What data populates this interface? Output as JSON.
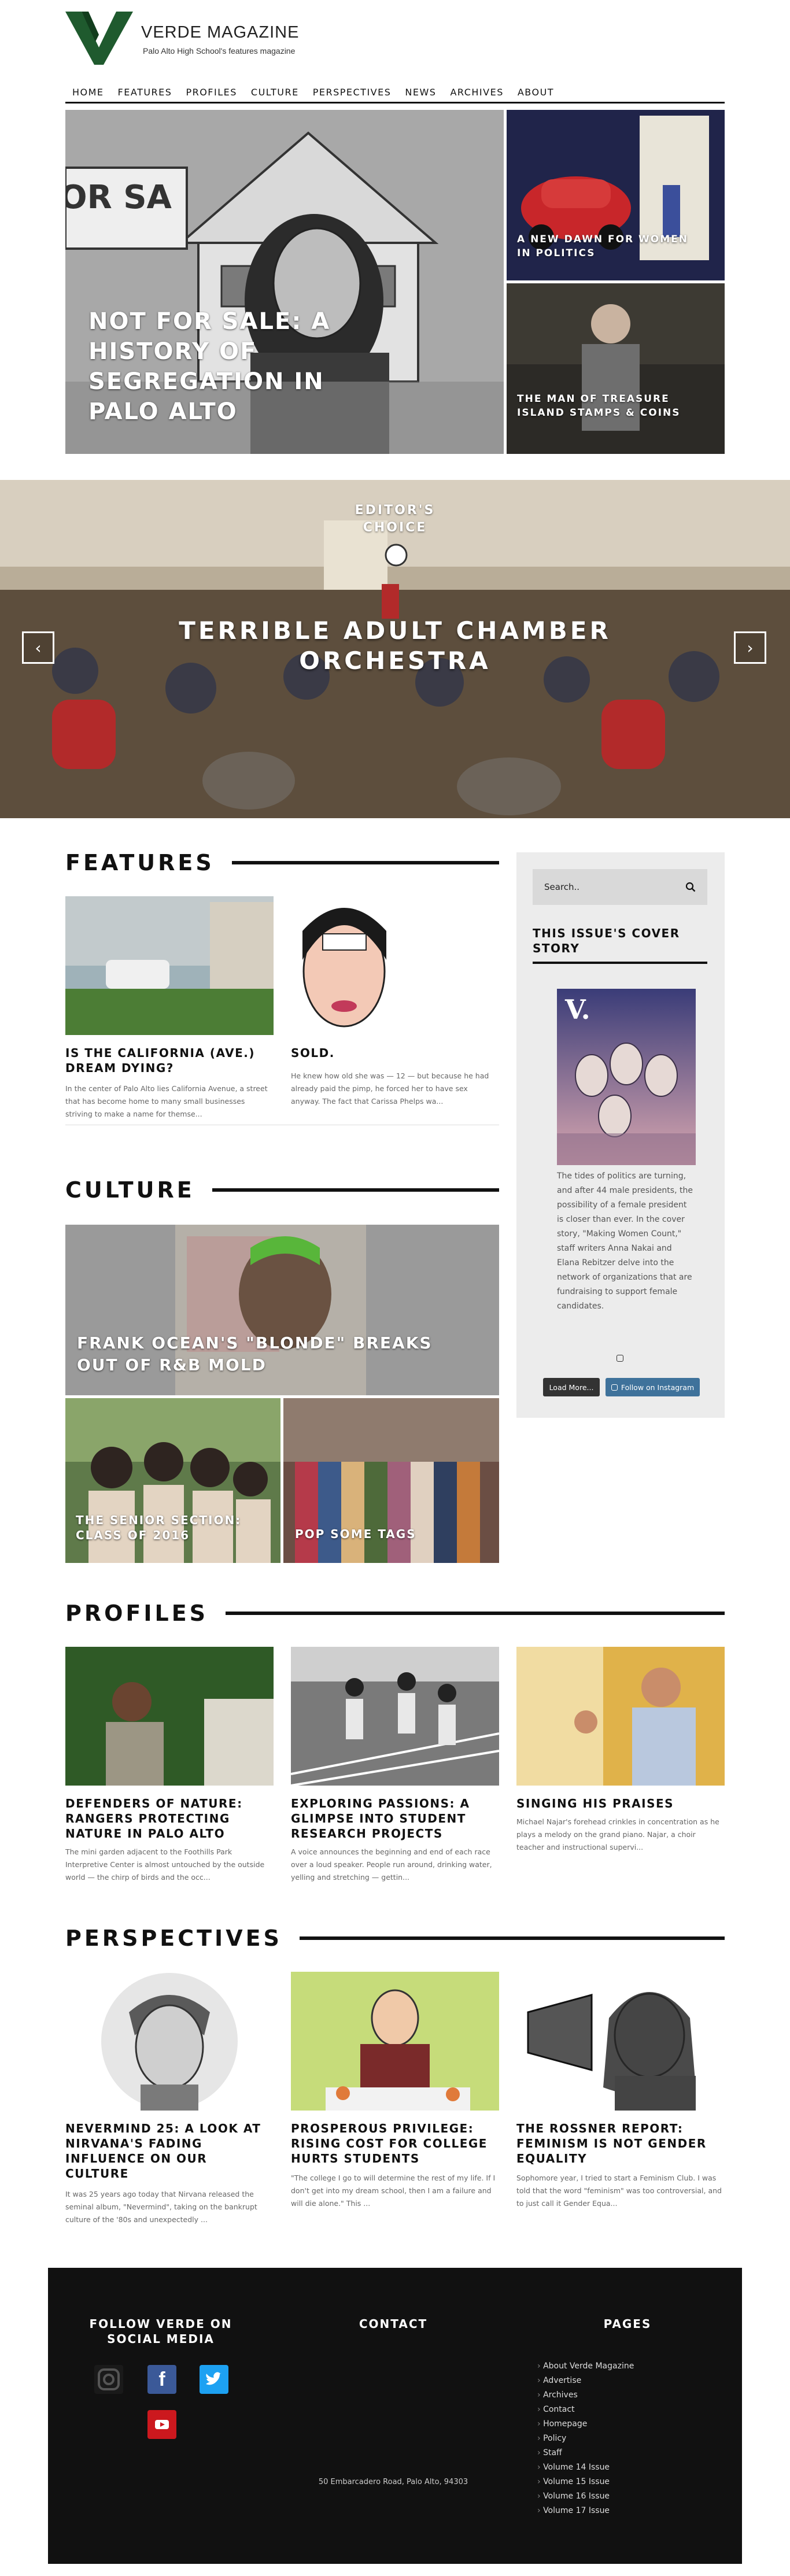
{
  "header": {
    "logo_letter": "V",
    "brand_name": "VERDE MAGAZINE",
    "tagline": "Palo Alto High School's features magazine"
  },
  "nav": [
    "HOME",
    "FEATURES",
    "PROFILES",
    "CULTURE",
    "PERSPECTIVES",
    "NEWS",
    "ARCHIVES",
    "ABOUT"
  ],
  "hero": {
    "main_title": "NOT FOR SALE: A HISTORY OF SEGREGATION IN PALO ALTO",
    "side_top_title": "A NEW DAWN FOR WOMEN IN POLITICS",
    "side_bottom_title": "THE MAN OF TREASURE ISLAND STAMPS & COINS"
  },
  "editors_choice": {
    "label_line1": "EDITOR'S",
    "label_line2": "CHOICE",
    "title_line1": "TERRIBLE ADULT CHAMBER",
    "title_line2": "ORCHESTRA",
    "prev": "‹",
    "next": "›"
  },
  "features": {
    "heading": "FEATURES",
    "items": [
      {
        "title": "IS THE CALIFORNIA (AVE.) DREAM DYING?",
        "text": "In the center of Palo Alto lies California Avenue, a street that has become home to many small businesses striving to make a name for themse..."
      },
      {
        "title": "SOLD.",
        "text": "He knew how old she was — 12 — but because he had already paid the pimp, he forced her to have sex anyway. The fact that Carissa Phelps wa..."
      }
    ]
  },
  "sidebar": {
    "search_placeholder": "Search..",
    "cover_title": "THIS ISSUE'S COVER STORY",
    "cover_text": "The tides of politics are turning, and after 44 male presidents, the possibility of a female president is closer than ever. In the cover story, \"Making Women Count,\" staff writers Anna Nakai and Elana Rebitzer delve into the network of organizations that are fundraising to support female candidates.",
    "load_more": "Load More...",
    "follow_instagram": "Follow on Instagram"
  },
  "culture": {
    "heading": "CULTURE",
    "main_title": "FRANK OCEAN'S \"BLONDE\" BREAKS OUT OF R&B MOLD",
    "left_title": "THE SENIOR SECTION: CLASS OF 2016",
    "right_title": "POP SOME TAGS"
  },
  "profiles": {
    "heading": "PROFILES",
    "items": [
      {
        "title": "DEFENDERS OF NATURE: RANGERS PROTECTING NATURE IN PALO ALTO",
        "text": "The mini garden adjacent to the Foothills Park Interpretive Center is almost untouched by the outside world — the chirp of birds and the occ..."
      },
      {
        "title": "EXPLORING PASSIONS: A GLIMPSE INTO STUDENT RESEARCH PROJECTS",
        "text": "A voice announces the beginning and end of each race over a loud speaker. People run around, drinking water, yelling and stretching — gettin..."
      },
      {
        "title": "SINGING HIS PRAISES",
        "text": "Michael Najar's forehead crinkles in concentration as he plays a melody on the grand piano. Najar, a choir teacher and instructional supervi..."
      }
    ]
  },
  "perspectives": {
    "heading": "PERSPECTIVES",
    "items": [
      {
        "title": "NEVERMIND 25: A LOOK AT NIRVANA'S FADING INFLUENCE ON OUR CULTURE",
        "text": "It was 25 years ago today that Nirvana released the seminal album, \"Nevermind\", taking on the bankrupt culture of the '80s and unexpectedly ..."
      },
      {
        "title": "PROSPEROUS PRIVILEGE: RISING COST FOR COLLEGE HURTS STUDENTS",
        "text": "\"The college I go to will determine the rest of my life. If I don't get into my dream school, then I am a failure and will die alone.\" This ..."
      },
      {
        "title": "THE ROSSNER REPORT: FEMINISM IS NOT GENDER EQUALITY",
        "text": "Sophomore year, I tried to start a Feminism Club. I was told that the word \"feminism\" was too controversial, and to just call it Gender Equa..."
      }
    ]
  },
  "footer": {
    "follow_heading": "FOLLOW VERDE ON SOCIAL MEDIA",
    "contact_heading": "CONTACT",
    "pages_heading": "PAGES",
    "address": "50 Embarcadero Road, Palo Alto, 94303",
    "pages": [
      "About Verde Magazine",
      "Advertise",
      "Archives",
      "Contact",
      "Homepage",
      "Policy",
      "Staff",
      "Volume 14 Issue",
      "Volume 15 Issue",
      "Volume 16 Issue",
      "Volume 17 Issue"
    ]
  }
}
